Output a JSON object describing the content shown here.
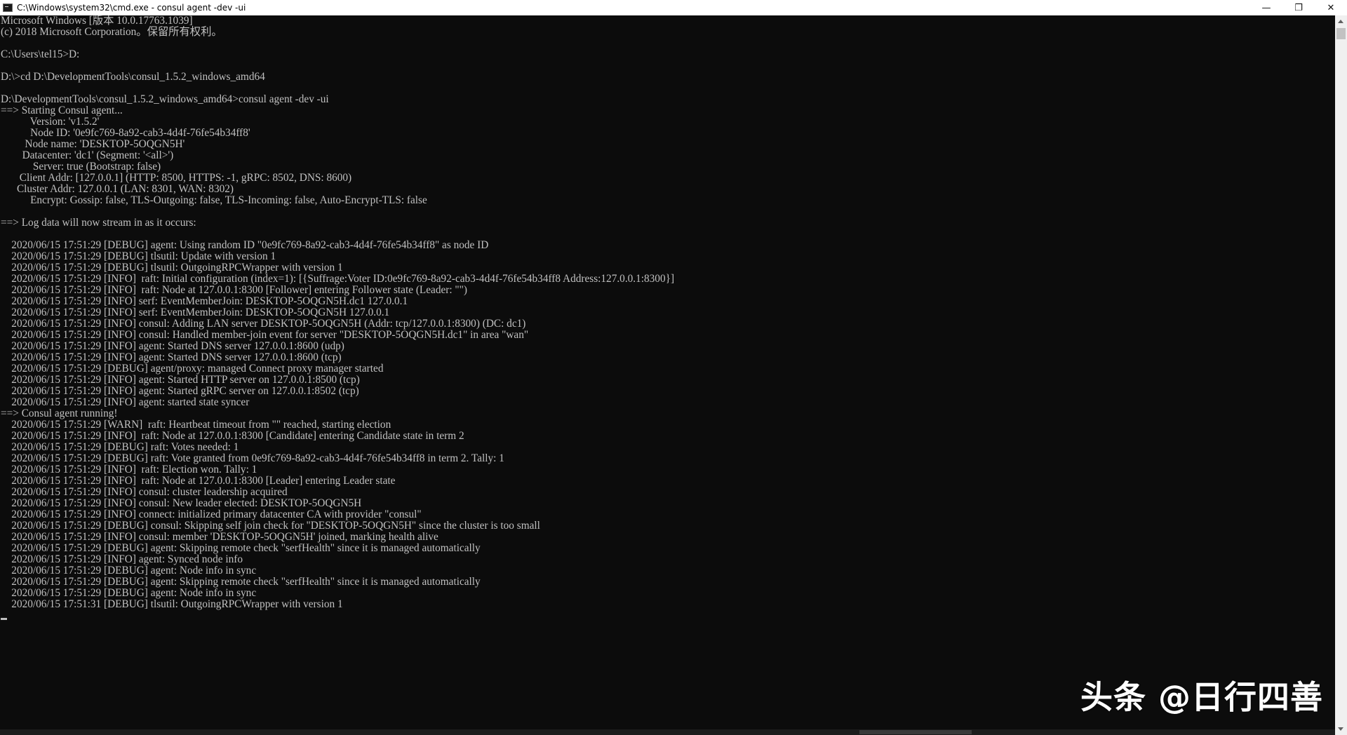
{
  "window": {
    "title": "C:\\Windows\\system32\\cmd.exe - consul  agent -dev -ui",
    "controls": {
      "minimize": "—",
      "restore": "❐",
      "close": "✕"
    }
  },
  "console": {
    "lines": [
      "Microsoft Windows [版本 10.0.17763.1039]",
      "(c) 2018 Microsoft Corporation。保留所有权利。",
      "",
      "C:\\Users\\tel15>D:",
      "",
      "D:\\>cd D:\\DevelopmentTools\\consul_1.5.2_windows_amd64",
      "",
      "D:\\DevelopmentTools\\consul_1.5.2_windows_amd64>consul agent -dev -ui",
      "==> Starting Consul agent...",
      "           Version: 'v1.5.2'",
      "           Node ID: '0e9fc769-8a92-cab3-4d4f-76fe54b34ff8'",
      "         Node name: 'DESKTOP-5OQGN5H'",
      "        Datacenter: 'dc1' (Segment: '<all>')",
      "            Server: true (Bootstrap: false)",
      "       Client Addr: [127.0.0.1] (HTTP: 8500, HTTPS: -1, gRPC: 8502, DNS: 8600)",
      "      Cluster Addr: 127.0.0.1 (LAN: 8301, WAN: 8302)",
      "           Encrypt: Gossip: false, TLS-Outgoing: false, TLS-Incoming: false, Auto-Encrypt-TLS: false",
      "",
      "==> Log data will now stream in as it occurs:",
      "",
      "    2020/06/15 17:51:29 [DEBUG] agent: Using random ID \"0e9fc769-8a92-cab3-4d4f-76fe54b34ff8\" as node ID",
      "    2020/06/15 17:51:29 [DEBUG] tlsutil: Update with version 1",
      "    2020/06/15 17:51:29 [DEBUG] tlsutil: OutgoingRPCWrapper with version 1",
      "    2020/06/15 17:51:29 [INFO]  raft: Initial configuration (index=1): [{Suffrage:Voter ID:0e9fc769-8a92-cab3-4d4f-76fe54b34ff8 Address:127.0.0.1:8300}]",
      "    2020/06/15 17:51:29 [INFO]  raft: Node at 127.0.0.1:8300 [Follower] entering Follower state (Leader: \"\")",
      "    2020/06/15 17:51:29 [INFO] serf: EventMemberJoin: DESKTOP-5OQGN5H.dc1 127.0.0.1",
      "    2020/06/15 17:51:29 [INFO] serf: EventMemberJoin: DESKTOP-5OQGN5H 127.0.0.1",
      "    2020/06/15 17:51:29 [INFO] consul: Adding LAN server DESKTOP-5OQGN5H (Addr: tcp/127.0.0.1:8300) (DC: dc1)",
      "    2020/06/15 17:51:29 [INFO] consul: Handled member-join event for server \"DESKTOP-5OQGN5H.dc1\" in area \"wan\"",
      "    2020/06/15 17:51:29 [INFO] agent: Started DNS server 127.0.0.1:8600 (udp)",
      "    2020/06/15 17:51:29 [INFO] agent: Started DNS server 127.0.0.1:8600 (tcp)",
      "    2020/06/15 17:51:29 [DEBUG] agent/proxy: managed Connect proxy manager started",
      "    2020/06/15 17:51:29 [INFO] agent: Started HTTP server on 127.0.0.1:8500 (tcp)",
      "    2020/06/15 17:51:29 [INFO] agent: Started gRPC server on 127.0.0.1:8502 (tcp)",
      "    2020/06/15 17:51:29 [INFO] agent: started state syncer",
      "==> Consul agent running!",
      "    2020/06/15 17:51:29 [WARN]  raft: Heartbeat timeout from \"\" reached, starting election",
      "    2020/06/15 17:51:29 [INFO]  raft: Node at 127.0.0.1:8300 [Candidate] entering Candidate state in term 2",
      "    2020/06/15 17:51:29 [DEBUG] raft: Votes needed: 1",
      "    2020/06/15 17:51:29 [DEBUG] raft: Vote granted from 0e9fc769-8a92-cab3-4d4f-76fe54b34ff8 in term 2. Tally: 1",
      "    2020/06/15 17:51:29 [INFO]  raft: Election won. Tally: 1",
      "    2020/06/15 17:51:29 [INFO]  raft: Node at 127.0.0.1:8300 [Leader] entering Leader state",
      "    2020/06/15 17:51:29 [INFO] consul: cluster leadership acquired",
      "    2020/06/15 17:51:29 [INFO] consul: New leader elected: DESKTOP-5OQGN5H",
      "    2020/06/15 17:51:29 [INFO] connect: initialized primary datacenter CA with provider \"consul\"",
      "    2020/06/15 17:51:29 [DEBUG] consul: Skipping self join check for \"DESKTOP-5OQGN5H\" since the cluster is too small",
      "    2020/06/15 17:51:29 [INFO] consul: member 'DESKTOP-5OQGN5H' joined, marking health alive",
      "    2020/06/15 17:51:29 [DEBUG] agent: Skipping remote check \"serfHealth\" since it is managed automatically",
      "    2020/06/15 17:51:29 [INFO] agent: Synced node info",
      "    2020/06/15 17:51:29 [DEBUG] agent: Node info in sync",
      "    2020/06/15 17:51:29 [DEBUG] agent: Skipping remote check \"serfHealth\" since it is managed automatically",
      "    2020/06/15 17:51:29 [DEBUG] agent: Node info in sync",
      "    2020/06/15 17:51:31 [DEBUG] tlsutil: OutgoingRPCWrapper with version 1"
    ]
  },
  "watermark": {
    "text": "头条 @日行四善"
  },
  "colors": {
    "console_bg": "#0c0c0c",
    "console_fg": "#c0c0c0",
    "titlebar_bg": "#ffffff"
  }
}
